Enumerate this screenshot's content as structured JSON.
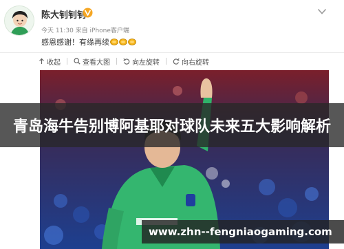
{
  "post": {
    "username": "陈大钊钊钊",
    "meta": "今天 11:30 来自 iPhone客户端",
    "text": "感恩感谢！有缘再续",
    "emoji_icons": [
      "praying-hands-icon",
      "praying-hands-icon",
      "praying-hands-icon"
    ],
    "verified_badge": "v-verified-icon",
    "accent_color": "#f5a623"
  },
  "toolbar": {
    "collapse": "收起",
    "view_large": "查看大图",
    "rotate_left": "向左旋转",
    "rotate_right": "向右旋转"
  },
  "overlay": {
    "title": "青岛海牛告别博阿基耶对球队未来五大影响解析",
    "watermark": "www.zhn--fengniaogaming.com"
  }
}
